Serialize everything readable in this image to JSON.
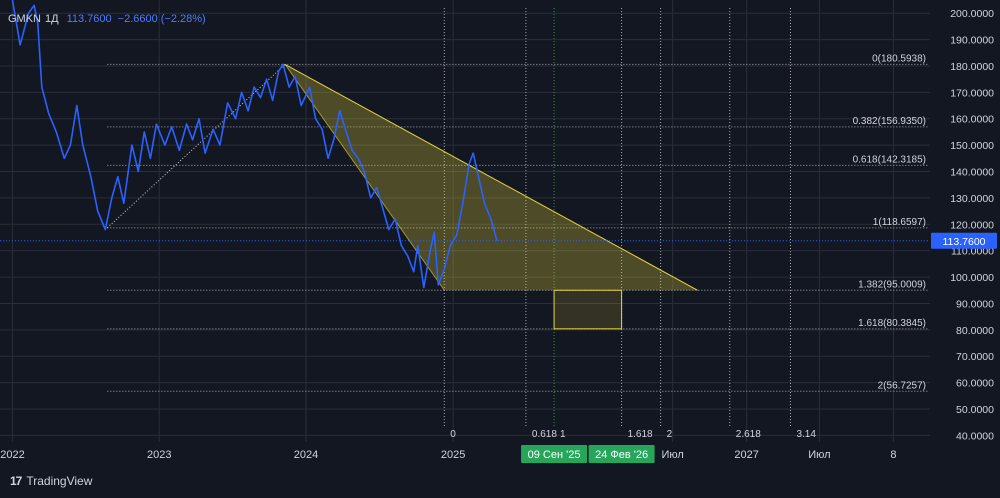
{
  "legend": {
    "symbol": "GMKN",
    "timeframe": "1Д",
    "last_price": "113.7600",
    "change": "−2.6600 (−2.28%)"
  },
  "branding": "TradingView",
  "colors": {
    "background": "#131722",
    "price_line": "#2962ff",
    "fib": "#e8d33a",
    "grid": "#2a2e39",
    "text": "#d1d4dc",
    "last_price_label": "#2962ff",
    "date_label": "#26a65b"
  },
  "chart_data": {
    "type": "line",
    "y_axis": {
      "range": [
        37.5,
        205
      ],
      "ticks": [
        "200.0000",
        "190.0000",
        "180.0000",
        "170.0000",
        "160.0000",
        "150.0000",
        "140.0000",
        "130.0000",
        "120.0000",
        "110.0000",
        "100.0000",
        "90.0000",
        "80.0000",
        "70.0000",
        "60.0000",
        "50.0000",
        "40.0000"
      ],
      "tick_values": [
        200,
        190,
        180,
        170,
        160,
        150,
        140,
        130,
        120,
        110,
        100,
        90,
        80,
        70,
        60,
        50,
        40
      ],
      "last_price": 113.76,
      "last_price_label": "113.7600"
    },
    "x_axis": {
      "range": [
        "2021-12-01",
        "2028-04-01"
      ],
      "ticks": [
        {
          "label": "2022",
          "date": "2022-01-01"
        },
        {
          "label": "2023",
          "date": "2023-01-01"
        },
        {
          "label": "2024",
          "date": "2024-01-01"
        },
        {
          "label": "2025",
          "date": "2025-01-01"
        },
        {
          "label": "Июл",
          "date": "2026-07-01"
        },
        {
          "label": "2027",
          "date": "2027-01-01"
        },
        {
          "label": "Июл",
          "date": "2027-07-01"
        },
        {
          "label": "8",
          "date": "2028-01-01"
        }
      ],
      "highlighted_dates": [
        {
          "label": "09 Сен '25",
          "date": "2025-09-09"
        },
        {
          "label": "24 Фев '26",
          "date": "2026-02-24"
        }
      ]
    },
    "series": [
      {
        "points": [
          [
            "2022-01-01",
            205
          ],
          [
            "2022-01-20",
            188
          ],
          [
            "2022-02-10",
            200
          ],
          [
            "2022-02-24",
            203
          ],
          [
            "2022-03-05",
            196
          ],
          [
            "2022-03-15",
            172
          ],
          [
            "2022-04-01",
            162
          ],
          [
            "2022-04-20",
            155
          ],
          [
            "2022-05-10",
            145
          ],
          [
            "2022-05-25",
            150
          ],
          [
            "2022-06-10",
            165
          ],
          [
            "2022-06-25",
            150
          ],
          [
            "2022-07-15",
            138
          ],
          [
            "2022-08-01",
            125
          ],
          [
            "2022-08-20",
            118
          ],
          [
            "2022-09-05",
            130
          ],
          [
            "2022-09-20",
            138
          ],
          [
            "2022-10-05",
            128
          ],
          [
            "2022-10-25",
            150
          ],
          [
            "2022-11-10",
            140
          ],
          [
            "2022-11-25",
            155
          ],
          [
            "2022-12-10",
            145
          ],
          [
            "2022-12-25",
            158
          ],
          [
            "2023-01-15",
            150
          ],
          [
            "2023-02-01",
            157
          ],
          [
            "2023-02-20",
            148
          ],
          [
            "2023-03-10",
            158
          ],
          [
            "2023-03-25",
            152
          ],
          [
            "2023-04-10",
            160
          ],
          [
            "2023-04-25",
            147
          ],
          [
            "2023-05-15",
            156
          ],
          [
            "2023-06-01",
            150
          ],
          [
            "2023-06-20",
            166
          ],
          [
            "2023-07-10",
            160
          ],
          [
            "2023-07-25",
            170
          ],
          [
            "2023-08-10",
            163
          ],
          [
            "2023-08-25",
            172
          ],
          [
            "2023-09-10",
            168
          ],
          [
            "2023-09-25",
            175
          ],
          [
            "2023-10-10",
            167
          ],
          [
            "2023-10-25",
            178
          ],
          [
            "2023-11-05",
            180.6
          ],
          [
            "2023-11-20",
            172
          ],
          [
            "2023-12-05",
            176
          ],
          [
            "2023-12-20",
            165
          ],
          [
            "2024-01-10",
            172
          ],
          [
            "2024-01-25",
            160
          ],
          [
            "2024-02-10",
            156
          ],
          [
            "2024-02-25",
            145
          ],
          [
            "2024-03-10",
            152
          ],
          [
            "2024-03-25",
            163
          ],
          [
            "2024-04-10",
            155
          ],
          [
            "2024-04-25",
            148
          ],
          [
            "2024-05-10",
            145
          ],
          [
            "2024-05-25",
            140
          ],
          [
            "2024-06-10",
            130
          ],
          [
            "2024-06-25",
            134
          ],
          [
            "2024-07-10",
            126
          ],
          [
            "2024-07-25",
            118
          ],
          [
            "2024-08-10",
            122
          ],
          [
            "2024-08-25",
            112
          ],
          [
            "2024-09-10",
            108
          ],
          [
            "2024-09-25",
            102
          ],
          [
            "2024-10-05",
            112
          ],
          [
            "2024-10-20",
            96
          ],
          [
            "2024-11-05",
            110
          ],
          [
            "2024-11-15",
            117
          ],
          [
            "2024-11-25",
            97
          ],
          [
            "2024-12-10",
            103
          ],
          [
            "2024-12-25",
            112
          ],
          [
            "2025-01-10",
            116
          ],
          [
            "2025-01-25",
            128
          ],
          [
            "2025-02-10",
            143
          ],
          [
            "2025-02-20",
            147
          ],
          [
            "2025-03-05",
            138
          ],
          [
            "2025-03-20",
            128
          ],
          [
            "2025-04-05",
            122
          ],
          [
            "2025-04-20",
            113.76
          ]
        ]
      }
    ],
    "fib_extension": {
      "points": [
        {
          "date": "2022-08-25",
          "value": 118.66
        },
        {
          "date": "2023-11-10",
          "value": 180.59
        },
        {
          "date": "2024-12-10",
          "value": 95.0
        },
        {
          "date": "2026-09-01",
          "value": 95.0
        }
      ],
      "price_levels": [
        {
          "ratio": 0,
          "label": "0(180.5938)",
          "value": 180.5938
        },
        {
          "ratio": 0.382,
          "label": "0.382(156.9350)",
          "value": 156.935
        },
        {
          "ratio": 0.618,
          "label": "0.618(142.3185)",
          "value": 142.3185
        },
        {
          "ratio": 1,
          "label": "1(118.6597)",
          "value": 118.6597
        },
        {
          "ratio": 1.382,
          "label": "1.382(95.0009)",
          "value": 95.0009
        },
        {
          "ratio": 1.618,
          "label": "1.618(80.3845)",
          "value": 80.3845
        },
        {
          "ratio": 2,
          "label": "2(56.7257)",
          "value": 56.7257
        }
      ],
      "time_levels": [
        {
          "label": "0",
          "date": "2024-12-10"
        },
        {
          "label": "0.618",
          "date": "2025-07-01"
        },
        {
          "label": "1",
          "date": "2025-09-09"
        },
        {
          "label": "1.618",
          "date": "2026-02-24"
        },
        {
          "label": "2",
          "date": "2026-06-01"
        },
        {
          "label": "2.618",
          "date": "2026-11-20"
        },
        {
          "label": "3.14",
          "date": "2027-04-20"
        }
      ],
      "target_zone": {
        "date_from": "2025-09-09",
        "date_to": "2026-02-24",
        "value_from": 80.3845,
        "value_to": 95.0009
      }
    }
  }
}
